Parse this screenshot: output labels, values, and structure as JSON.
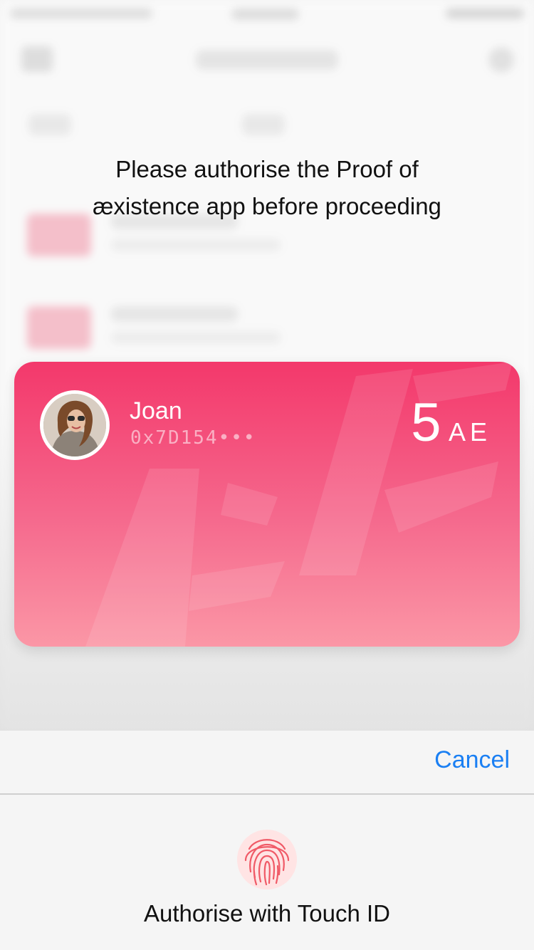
{
  "dialog": {
    "prompt_line1": "Please authorise the Proof of",
    "prompt_line2": "æxistence app before proceeding"
  },
  "card": {
    "name": "Joan",
    "address": "0x7D154•••",
    "balance_amount": "5",
    "balance_unit": "AE",
    "gradient_top": "#f3386b",
    "gradient_bottom": "#fb97a6"
  },
  "actions": {
    "cancel_label": "Cancel",
    "cancel_color": "#1a7ff3"
  },
  "touch_id": {
    "label": "Authorise with Touch ID",
    "icon": "fingerprint-icon",
    "icon_color": "#f05a67"
  }
}
